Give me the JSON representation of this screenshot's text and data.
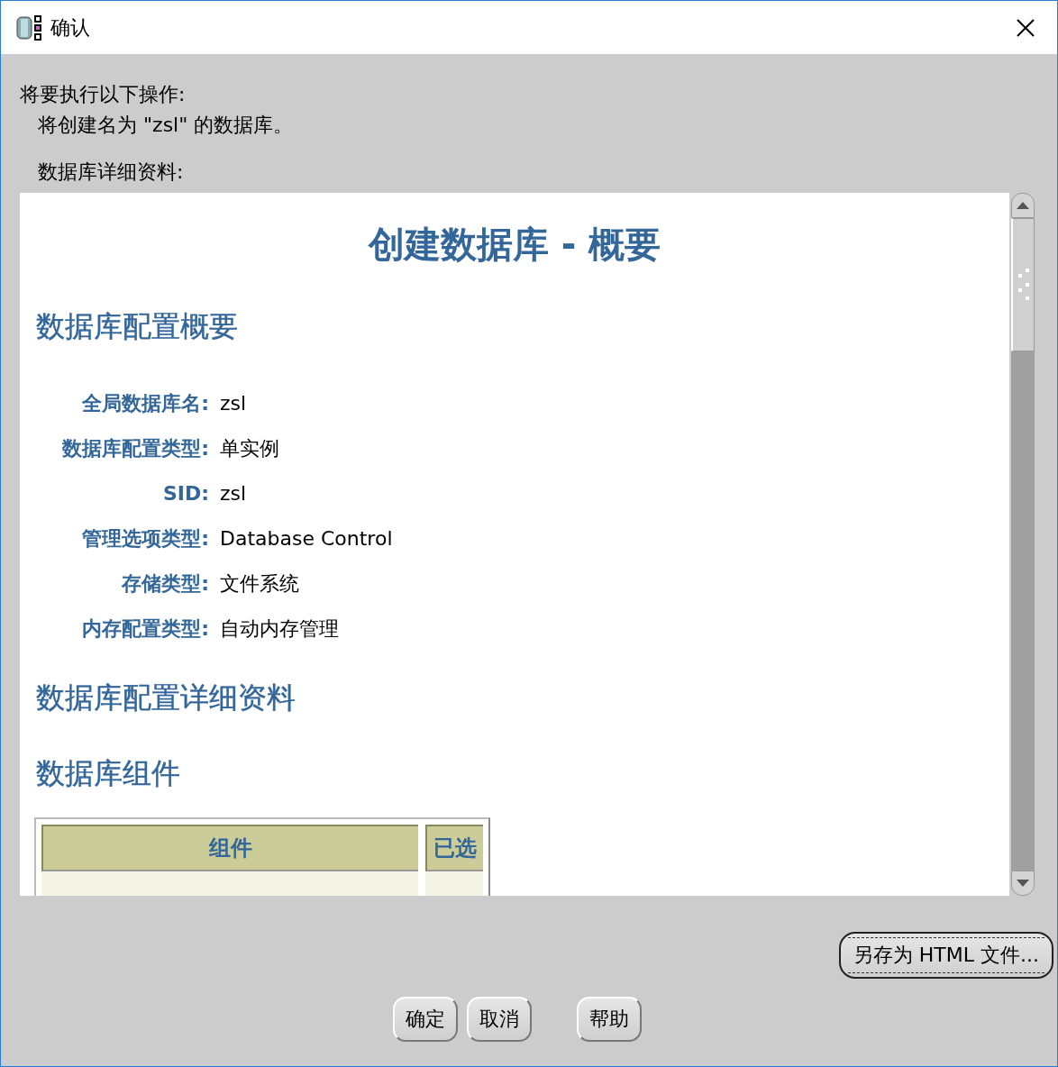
{
  "window": {
    "title": "确认"
  },
  "intro": "将要执行以下操作:",
  "action": "将创建名为 \"zsl\" 的数据库。",
  "details_label": "数据库详细资料:",
  "report": {
    "title": "创建数据库 - 概要",
    "sections": [
      {
        "heading": "数据库配置概要",
        "fields": [
          {
            "label": "全局数据库名:",
            "value": "zsl"
          },
          {
            "label": "数据库配置类型:",
            "value": "单实例"
          },
          {
            "label": "SID:",
            "value": "zsl"
          },
          {
            "label": "管理选项类型:",
            "value": "Database Control"
          },
          {
            "label": "存储类型:",
            "value": "文件系统"
          },
          {
            "label": "内存配置类型:",
            "value": "自动内存管理"
          }
        ]
      },
      {
        "heading": "数据库配置详细资料"
      },
      {
        "heading": "数据库组件",
        "table": {
          "columns": [
            "组件",
            "已选"
          ]
        }
      }
    ]
  },
  "save_button": {
    "label": "另存为 HTML 文件...",
    "focused": true
  },
  "footer_buttons": [
    [
      {
        "label": "确定"
      },
      {
        "label": "取消"
      }
    ],
    [
      {
        "label": "帮助"
      }
    ]
  ]
}
